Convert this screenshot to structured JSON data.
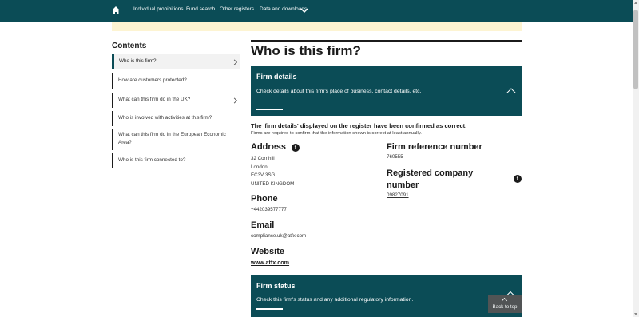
{
  "nav": {
    "items": [
      "Individual prohibitions",
      "Fund search",
      "Other registers",
      "Data and downloads"
    ]
  },
  "sidebar": {
    "title": "Contents",
    "items": [
      {
        "label": "Who is this firm?"
      },
      {
        "label": "How are customers protected?"
      },
      {
        "label": "What can this firm do in the UK?"
      },
      {
        "label": "Who is involved with activities at this firm?"
      },
      {
        "label": "What can this firm do in the European Economic Area?"
      },
      {
        "label": "Who is this firm connected to?"
      }
    ]
  },
  "main": {
    "title": "Who is this firm?",
    "firm_details": {
      "title": "Firm details",
      "text": "Check details about this firm's place of business, contact details, etc."
    },
    "confirm_title": "The 'firm details' displayed on the register have been confirmed as correct.",
    "confirm_sub": "Firms are required to confirm that the information shown is correct at least annually.",
    "address": {
      "heading": "Address",
      "lines": [
        "32 Cornhill",
        "London",
        "EC3V 3SG",
        "UNITED KINGDOM"
      ]
    },
    "phone": {
      "heading": "Phone",
      "value": "+442039577777"
    },
    "email": {
      "heading": "Email",
      "value": "compliance.uk@atfx.com"
    },
    "website": {
      "heading": "Website",
      "value": "www.atfx.com"
    },
    "frn": {
      "heading": "Firm reference number",
      "value": "760555"
    },
    "company": {
      "heading_line1": "Registered company",
      "heading_line2": "number",
      "value": "09827091"
    },
    "firm_status": {
      "title": "Firm status",
      "text": "Check this firm's status and any additional regulatory information."
    }
  },
  "back_to_top": "Back to top",
  "colors": {
    "brand": "#0b4c56",
    "banner": "#fdf4d2"
  }
}
